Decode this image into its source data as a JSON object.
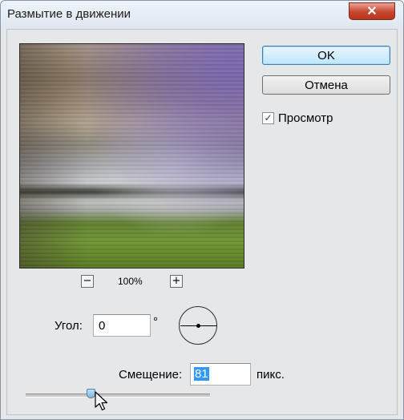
{
  "window": {
    "title": "Размытие в движении",
    "close_label": "✕"
  },
  "preview": {
    "zoom_out_label": "−",
    "zoom_in_label": "+",
    "zoom_level": "100%"
  },
  "buttons": {
    "ok_label": "OK",
    "cancel_label": "Отмена"
  },
  "preview_toggle": {
    "label": "Просмотр",
    "checked": true,
    "check_glyph": "✓"
  },
  "angle": {
    "label": "Угол:",
    "value": "0",
    "unit": "°"
  },
  "offset": {
    "label": "Смещение:",
    "value": "81",
    "unit": "пикс."
  },
  "slider": {
    "position_fraction": 0.35
  },
  "colors": {
    "ok_accent": "#3c7fb1",
    "close_button": "#c7452c",
    "selection": "#3399ff",
    "slider_thumb": "#7fb5d9"
  }
}
